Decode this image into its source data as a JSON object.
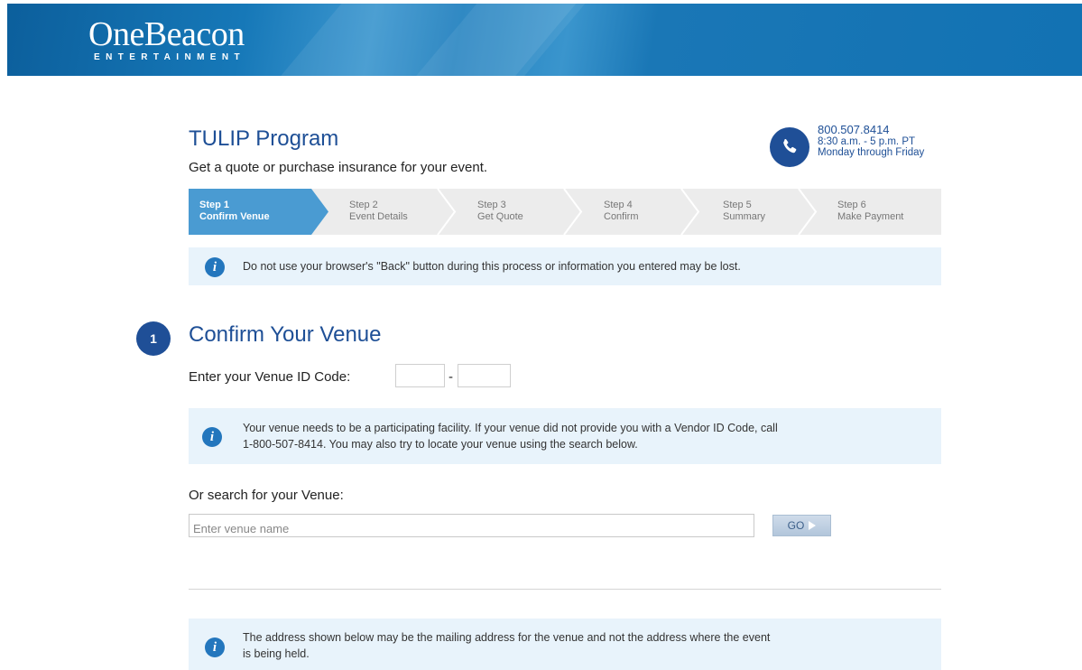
{
  "header": {
    "logo_main": "OneBeacon",
    "logo_sub": "ENTERTAINMENT"
  },
  "program": {
    "title": "TULIP Program",
    "subtitle": "Get a quote or purchase insurance for your event."
  },
  "contact": {
    "phone": "800.507.8414",
    "hours": "8:30 a.m. - 5 p.m. PT",
    "days": "Monday through Friday",
    "icon": "phone-icon"
  },
  "steps": [
    {
      "step": "Step 1",
      "label": "Confirm Venue",
      "active": true
    },
    {
      "step": "Step 2",
      "label": "Event Details",
      "active": false
    },
    {
      "step": "Step 3",
      "label": "Get Quote",
      "active": false
    },
    {
      "step": "Step 4",
      "label": "Confirm",
      "active": false
    },
    {
      "step": "Step 5",
      "label": "Summary",
      "active": false
    },
    {
      "step": "Step 6",
      "label": "Make Payment",
      "active": false
    }
  ],
  "notices": {
    "back_button": "Do not use your browser's \"Back\" button during this process or information you entered may be lost.",
    "participating_line1": "Your venue needs to be a participating facility. If your venue did not provide you with a Vendor ID Code, call",
    "participating_line2": "1-800-507-8414. You may also try to locate your venue using the search below.",
    "address_line1": "The address shown below may be the mailing address for the venue and not the address where the event",
    "address_line2": "is being held.",
    "icon_glyph": "i"
  },
  "section": {
    "number": "1",
    "title": "Confirm Your Venue"
  },
  "venue_code": {
    "label": "Enter your Venue ID Code:",
    "separator": "-",
    "part1_value": "",
    "part2_value": ""
  },
  "search": {
    "label": "Or search for your Venue:",
    "placeholder": "Enter venue name",
    "value": "",
    "go_label": "GO"
  },
  "colors": {
    "brand_blue": "#1f4f97",
    "header_blue": "#1272b3",
    "active_step": "#4a9bd2",
    "info_bg": "#e8f3fb"
  }
}
